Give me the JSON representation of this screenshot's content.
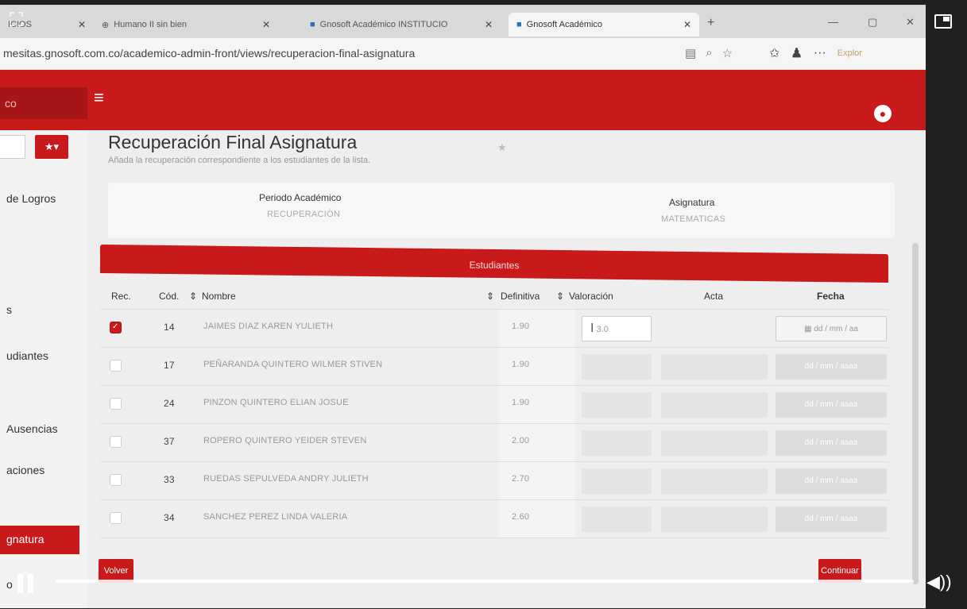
{
  "browser": {
    "tabs": [
      {
        "label": "ICIOS",
        "icon": "page-icon"
      },
      {
        "label": "Humano II sin bien",
        "icon": "globe-icon"
      },
      {
        "label": "Gnosoft Académico INSTITUCIO",
        "icon": "gnosoft-icon"
      },
      {
        "label": "Gnosoft Académico",
        "icon": "gnosoft-icon"
      }
    ],
    "url": "mesitas.gnosoft.com.co/academico-admin-front/views/recuperacion-final-asignatura",
    "profile_label": "Explor"
  },
  "app": {
    "brand": "co",
    "sidebar": {
      "items": [
        {
          "label": "de Logros",
          "active": false
        },
        {
          "label": "s",
          "active": false
        },
        {
          "label": "udiantes",
          "active": false
        },
        {
          "label": "Ausencias",
          "active": false
        },
        {
          "label": "aciones",
          "active": false
        },
        {
          "label": "gnatura",
          "active": true
        },
        {
          "label": "o",
          "active": false
        }
      ]
    },
    "page": {
      "title": "Recuperación Final Asignatura",
      "subtitle": "Añada la recuperación correspondiente a los estudiantes de la lista."
    },
    "filters": {
      "periodo_label": "Periodo Académico",
      "periodo_value": "RECUPERACIÓN",
      "asignatura_label": "Asignatura",
      "asignatura_value": "MATEMATICAS"
    },
    "table": {
      "title": "Estudiantes",
      "columns": {
        "rec": "Rec.",
        "cod": "Cód.",
        "nombre": "Nombre",
        "definitiva": "Definitiva",
        "valoracion": "Valoración",
        "acta": "Acta",
        "fecha": "Fecha"
      },
      "rows": [
        {
          "checked": true,
          "cod": "14",
          "nombre": "JAIMES DIAZ KAREN YULIETH",
          "definitiva": "1.90",
          "valoracion": "3.0",
          "fecha": "dd / mm / aa"
        },
        {
          "checked": false,
          "cod": "17",
          "nombre": "PEÑARANDA QUINTERO WILMER STIVEN",
          "definitiva": "1.90",
          "valoracion": "",
          "fecha": "dd / mm / aaaa"
        },
        {
          "checked": false,
          "cod": "24",
          "nombre": "PINZON QUINTERO ELIAN JOSUE",
          "definitiva": "1.90",
          "valoracion": "",
          "fecha": "dd / mm / aaaa"
        },
        {
          "checked": false,
          "cod": "37",
          "nombre": "ROPERO QUINTERO YEIDER STEVEN",
          "definitiva": "2.00",
          "valoracion": "",
          "fecha": "dd / mm / aaaa"
        },
        {
          "checked": false,
          "cod": "33",
          "nombre": "RUEDAS SEPULVEDA ANDRY JULIETH",
          "definitiva": "2.70",
          "valoracion": "",
          "fecha": "dd / mm / aaaa"
        },
        {
          "checked": false,
          "cod": "34",
          "nombre": "SANCHEZ PEREZ LINDA VALERIA",
          "definitiva": "2.60",
          "valoracion": "",
          "fecha": "dd / mm / aaaa"
        }
      ]
    },
    "buttons": {
      "back": "Volver",
      "continue": "Continuar"
    }
  },
  "colors": {
    "brand_red": "#c8191b"
  }
}
